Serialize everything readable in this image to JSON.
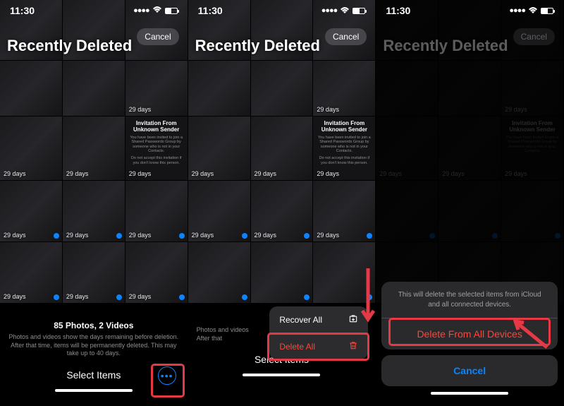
{
  "status": {
    "time": "11:30"
  },
  "title": "Recently Deleted",
  "cancel": "Cancel",
  "days": "29 days",
  "invitation": {
    "title": "Invitation From Unknown Sender",
    "body": "You have been invited to join a Shared Passwords Group by someone who is not in your Contacts.",
    "warn": "Do not accept this invitation if you don't know this person."
  },
  "summary": {
    "title": "85 Photos, 2 Videos",
    "body": "Photos and videos show the days remaining before deletion. After that time, items will be permanently deleted. This may take up to 40 days."
  },
  "summary_trunc_a": "Photos and videos",
  "summary_trunc_b": "After that",
  "select_items": "Select Items",
  "menu": {
    "recover": "Recover All",
    "delete": "Delete All"
  },
  "sheet": {
    "message": "This will delete the selected items from iCloud and all connected devices.",
    "delete": "Delete From All Devices",
    "cancel": "Cancel"
  }
}
